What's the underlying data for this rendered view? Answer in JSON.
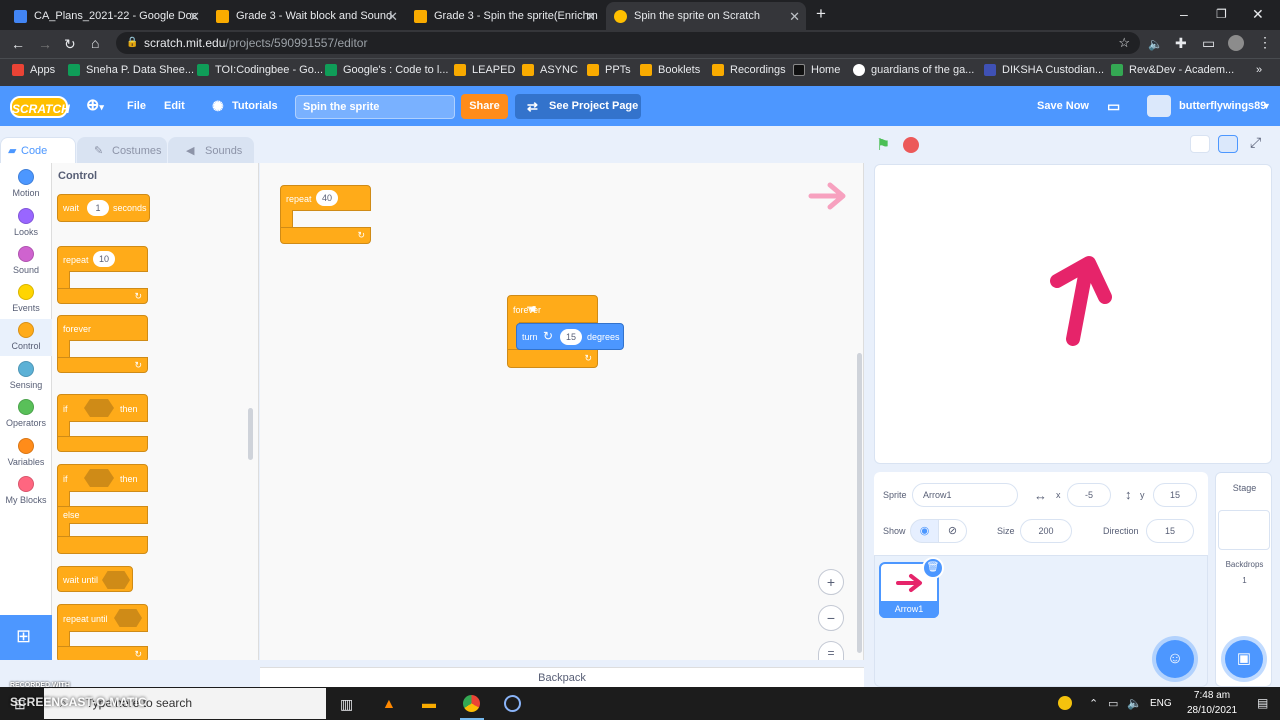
{
  "tabs": [
    {
      "title": "CA_Plans_2021-22 - Google Doc",
      "color": "#4285f4"
    },
    {
      "title": "Grade 3 - Wait block and Sound",
      "color": "#f9ab00"
    },
    {
      "title": "Grade 3 - Spin the sprite(Enrichm",
      "color": "#f9ab00"
    },
    {
      "title": "Spin the sprite on Scratch",
      "color": "#ffbf00"
    }
  ],
  "address": {
    "domain": "scratch.mit.edu",
    "path": "/projects/590991557/editor"
  },
  "bookmarks": [
    {
      "label": "Apps",
      "color": "#ea4335"
    },
    {
      "label": "Sneha P. Data Shee...",
      "color": "#0f9d58"
    },
    {
      "label": "TOI:Codingbee - Go...",
      "color": "#0f9d58"
    },
    {
      "label": "Google's : Code to l...",
      "color": "#0f9d58"
    },
    {
      "label": "LEAPED",
      "color": "#f9ab00"
    },
    {
      "label": "ASYNC",
      "color": "#f9ab00"
    },
    {
      "label": "PPTs",
      "color": "#f9ab00"
    },
    {
      "label": "Booklets",
      "color": "#f9ab00"
    },
    {
      "label": "Recordings",
      "color": "#f9ab00"
    },
    {
      "label": "Home",
      "color": "#111111"
    },
    {
      "label": "guardians of the ga...",
      "color": "#4285f4"
    },
    {
      "label": "DIKSHA Custodian...",
      "color": "#3f51b5"
    },
    {
      "label": "Rev&Dev - Academ...",
      "color": "#34a853"
    }
  ],
  "menu": {
    "logo": "SCRATCH",
    "file": "File",
    "edit": "Edit",
    "tutorials": "Tutorials",
    "project_title": "Spin the sprite",
    "share": "Share",
    "see_project": "See Project Page",
    "save_now": "Save Now",
    "username": "butterflywings89"
  },
  "editor_tabs": {
    "code": "Code",
    "costumes": "Costumes",
    "sounds": "Sounds"
  },
  "categories": [
    {
      "label": "Motion",
      "color": "#4c97ff"
    },
    {
      "label": "Looks",
      "color": "#9966ff"
    },
    {
      "label": "Sound",
      "color": "#cf63cf"
    },
    {
      "label": "Events",
      "color": "#ffd500"
    },
    {
      "label": "Control",
      "color": "#ffab19"
    },
    {
      "label": "Sensing",
      "color": "#5cb1d6"
    },
    {
      "label": "Operators",
      "color": "#59c059"
    },
    {
      "label": "Variables",
      "color": "#ff8c1a"
    },
    {
      "label": "My Blocks",
      "color": "#ff6680"
    }
  ],
  "palette": {
    "heading": "Control",
    "wait": {
      "label": "wait",
      "value": "1",
      "suffix": "seconds"
    },
    "repeat": {
      "label": "repeat",
      "value": "10"
    },
    "forever": "forever",
    "if_then": {
      "if": "if",
      "then": "then"
    },
    "if_else": {
      "if": "if",
      "then": "then",
      "else": "else"
    },
    "wait_until": "wait until",
    "repeat_until": "repeat until"
  },
  "script": {
    "repeat": {
      "label": "repeat",
      "value": "40"
    },
    "forever": "forever",
    "turn": {
      "label": "turn",
      "value": "15",
      "suffix": "degrees"
    }
  },
  "backpack": "Backpack",
  "sprite_info": {
    "sprite_label": "Sprite",
    "sprite_name": "Arrow1",
    "x_label": "x",
    "x": "-5",
    "y_label": "y",
    "y": "15",
    "show_label": "Show",
    "size_label": "Size",
    "size": "200",
    "direction_label": "Direction",
    "direction": "15"
  },
  "sprite_tile": "Arrow1",
  "stage_pane": {
    "title": "Stage",
    "backdrops_label": "Backdrops",
    "backdrops": "1"
  },
  "taskbar": {
    "search": "Type here to search",
    "lang": "ENG",
    "time": "7:48 am",
    "date": "28/10/2021",
    "watermark_top": "RECORDED WITH",
    "watermark": "SCREENCAST-O-MATIC"
  },
  "colors": {
    "menu_blue": "#4d97ff",
    "control": "#ffab19",
    "motion": "#4c97ff",
    "arrow": "#e6246a"
  }
}
